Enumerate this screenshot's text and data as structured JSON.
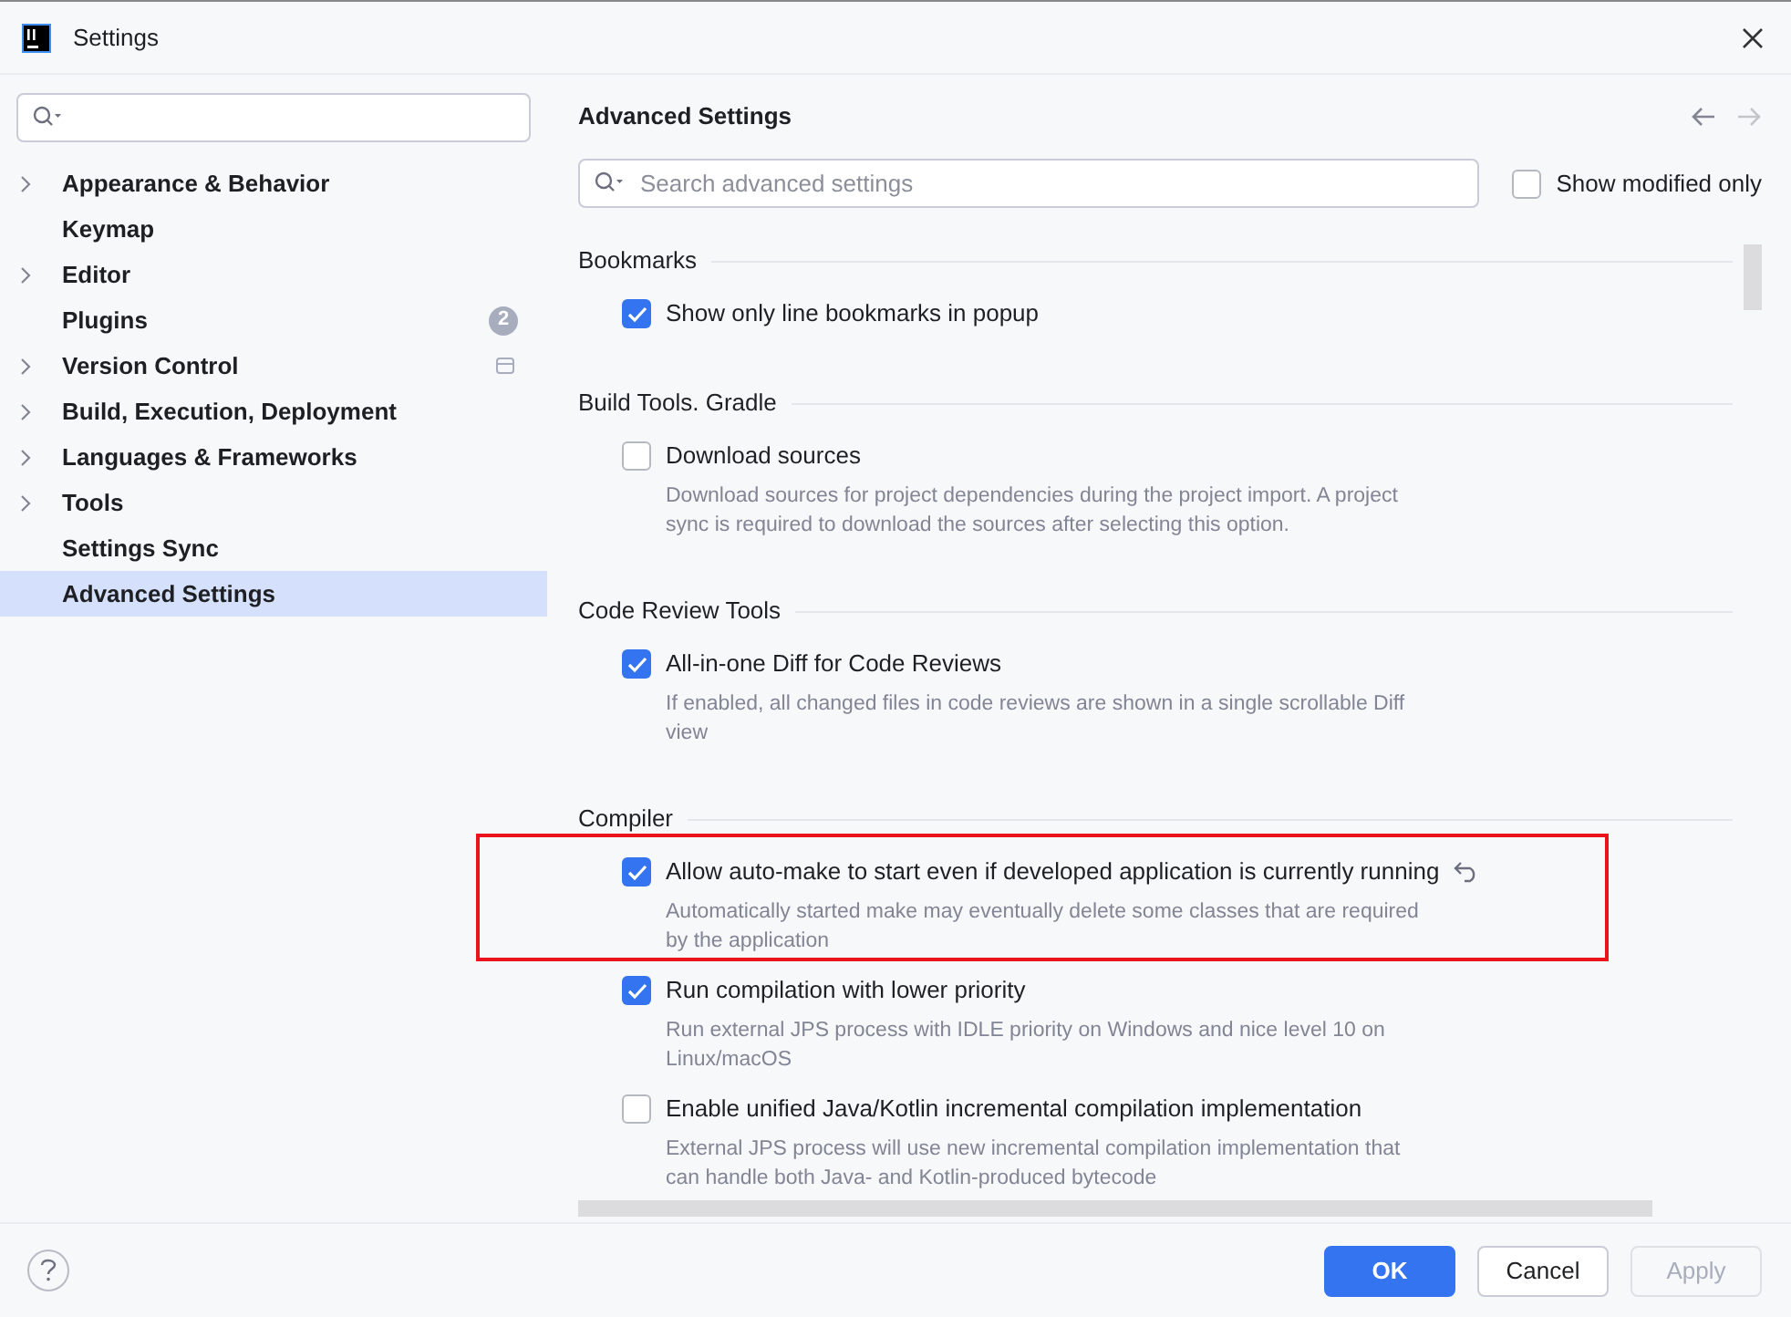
{
  "window": {
    "title": "Settings"
  },
  "sidebar": {
    "items": [
      {
        "label": "Appearance & Behavior",
        "expandable": true,
        "selected": false
      },
      {
        "label": "Keymap",
        "expandable": false,
        "selected": false
      },
      {
        "label": "Editor",
        "expandable": true,
        "selected": false
      },
      {
        "label": "Plugins",
        "expandable": false,
        "selected": false,
        "badge": "2"
      },
      {
        "label": "Version Control",
        "expandable": true,
        "selected": false,
        "project_marker": true
      },
      {
        "label": "Build, Execution, Deployment",
        "expandable": true,
        "selected": false
      },
      {
        "label": "Languages & Frameworks",
        "expandable": true,
        "selected": false
      },
      {
        "label": "Tools",
        "expandable": true,
        "selected": false
      },
      {
        "label": "Settings Sync",
        "expandable": false,
        "selected": false
      },
      {
        "label": "Advanced Settings",
        "expandable": false,
        "selected": true
      }
    ]
  },
  "content": {
    "title": "Advanced Settings",
    "search": {
      "placeholder": "Search advanced settings"
    },
    "show_modified_only": {
      "label": "Show modified only",
      "checked": false
    },
    "sections": [
      {
        "title": "Bookmarks",
        "items": [
          {
            "label": "Show only line bookmarks in popup",
            "checked": true,
            "modified": false,
            "annotated": false
          }
        ]
      },
      {
        "title": "Build Tools. Gradle",
        "items": [
          {
            "label": "Download sources",
            "checked": false,
            "modified": false,
            "annotated": false,
            "description": "Download sources for project dependencies during the project import. A project sync is required to download the sources after selecting this option."
          }
        ]
      },
      {
        "title": "Code Review Tools",
        "items": [
          {
            "label": "All-in-one Diff for Code Reviews",
            "checked": true,
            "modified": false,
            "annotated": false,
            "description": "If enabled, all changed files in code reviews are shown in a single scrollable Diff view"
          }
        ]
      },
      {
        "title": "Compiler",
        "items": [
          {
            "label": "Allow auto-make to start even if developed application is currently running",
            "checked": true,
            "modified": true,
            "annotated": true,
            "description": "Automatically started make may eventually delete some classes that are required by the application"
          },
          {
            "label": "Run compilation with lower priority",
            "checked": true,
            "modified": false,
            "annotated": false,
            "description": "Run external JPS process with IDLE priority on Windows and nice level 10 on Linux/macOS"
          },
          {
            "label": "Enable unified Java/Kotlin incremental compilation implementation",
            "checked": false,
            "modified": false,
            "annotated": false,
            "description": "External JPS process will use new incremental compilation implementation that can handle both Java- and Kotlin-produced bytecode"
          }
        ]
      }
    ]
  },
  "buttons": [
    {
      "label": "OK",
      "kind": "primary",
      "disabled": false
    },
    {
      "label": "Cancel",
      "kind": "secondary",
      "disabled": false
    },
    {
      "label": "Apply",
      "kind": "secondary",
      "disabled": true
    }
  ]
}
